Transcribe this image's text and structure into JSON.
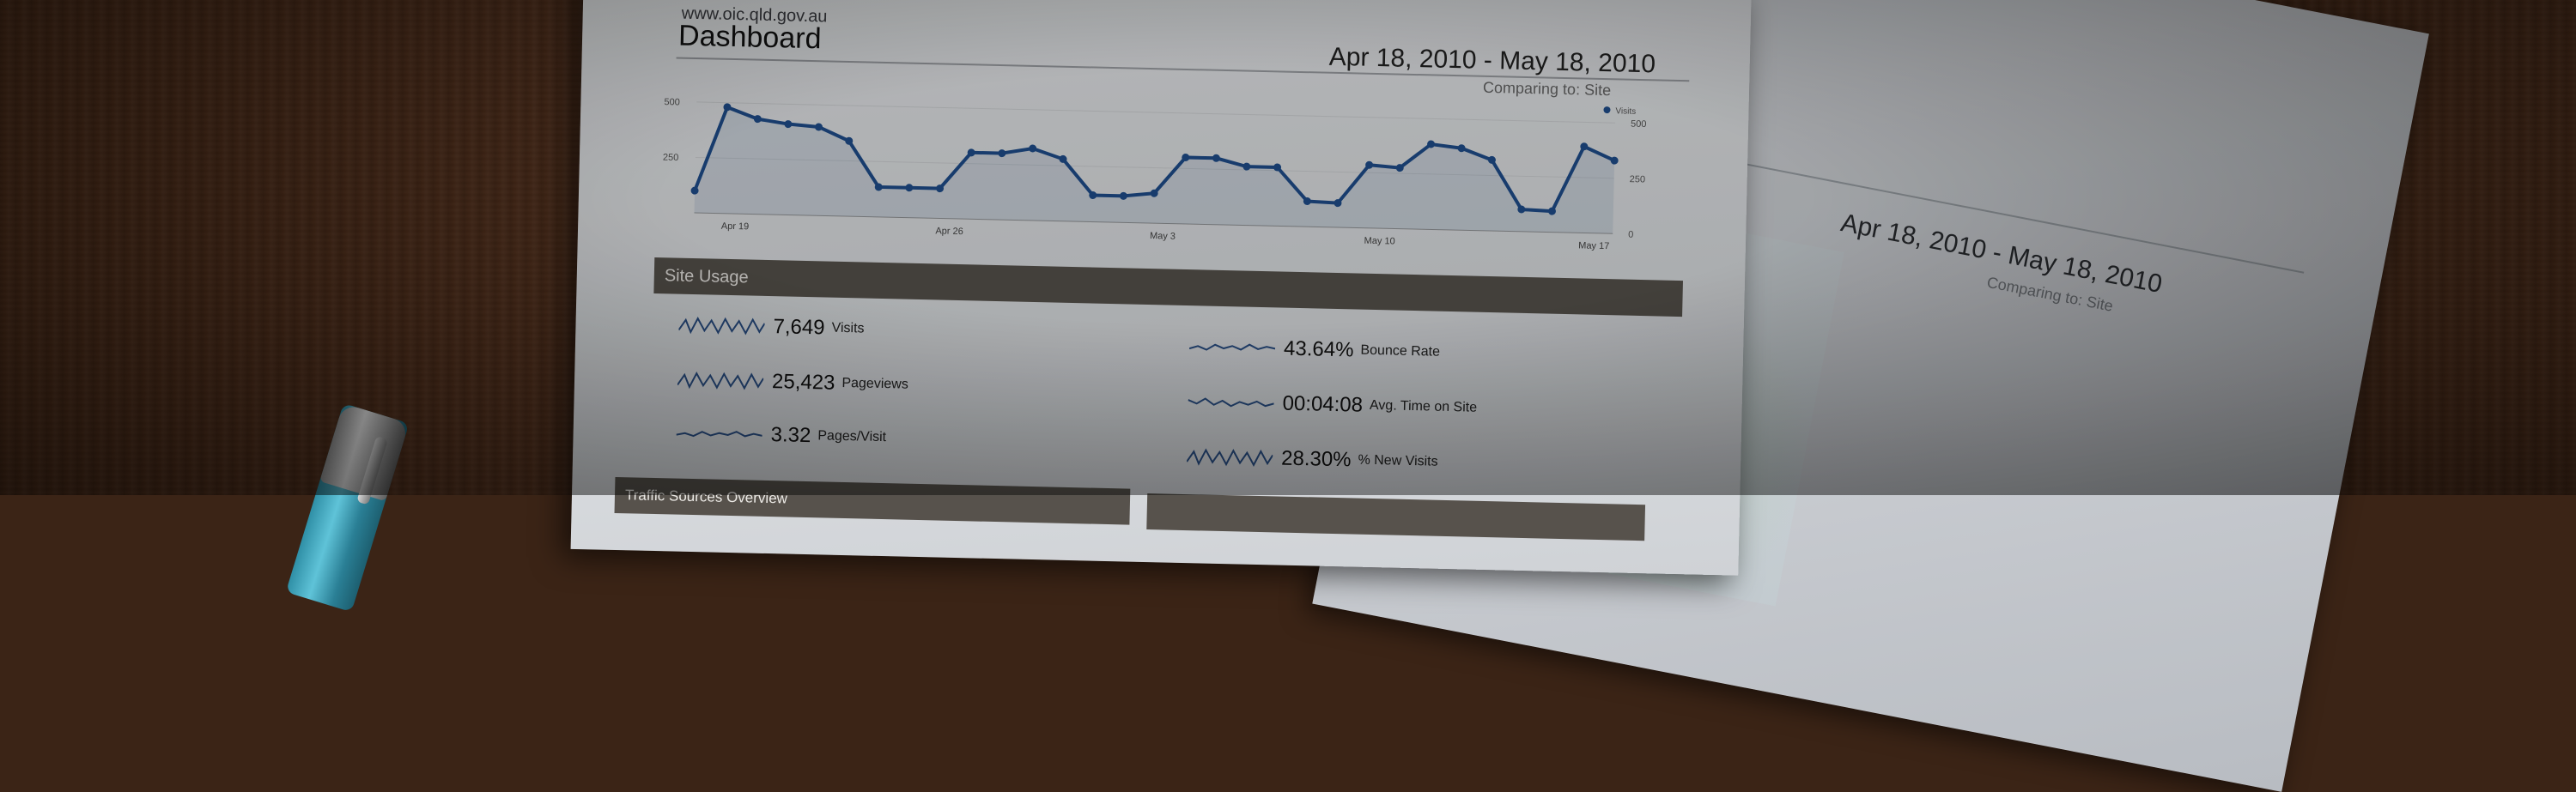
{
  "front_sheet": {
    "url": "www.oic.qld.gov.au",
    "title": "Dashboard",
    "date_range": "Apr 18, 2010 - May 18, 2010",
    "comparing": "Comparing to: Site"
  },
  "chart": {
    "legend_label": "Visits",
    "left_ticks": [
      "500",
      "250"
    ],
    "right_ticks": [
      "500",
      "250",
      "0"
    ],
    "x_labels": [
      "Apr 19",
      "Apr 26",
      "May 3",
      "May 10",
      "May 17"
    ],
    "values": [
      100,
      480,
      430,
      410,
      400,
      340,
      135,
      135,
      135,
      300,
      300,
      325,
      280,
      120,
      120,
      135,
      300,
      300,
      265,
      265,
      115,
      110,
      285,
      275,
      385,
      370,
      320,
      100,
      95,
      390,
      330
    ]
  },
  "site_usage": {
    "header": "Site Usage",
    "metrics": [
      {
        "value": "7,649",
        "label": "Visits"
      },
      {
        "value": "25,423",
        "label": "Pageviews"
      },
      {
        "value": "3.32",
        "label": "Pages/Visit"
      },
      {
        "value": "43.64%",
        "label": "Bounce Rate"
      },
      {
        "value": "00:04:08",
        "label": "Avg. Time on Site"
      },
      {
        "value": "28.30%",
        "label": "% New Visits"
      }
    ]
  },
  "traffic": {
    "header": "Traffic Sources Overview"
  },
  "back_sheet": {
    "date_range": "Apr 18, 2010 - May 18, 2010",
    "comparing": "Comparing to: Site"
  },
  "colors": {
    "line": "#1f4e8c",
    "section_bar": "#57524c"
  }
}
